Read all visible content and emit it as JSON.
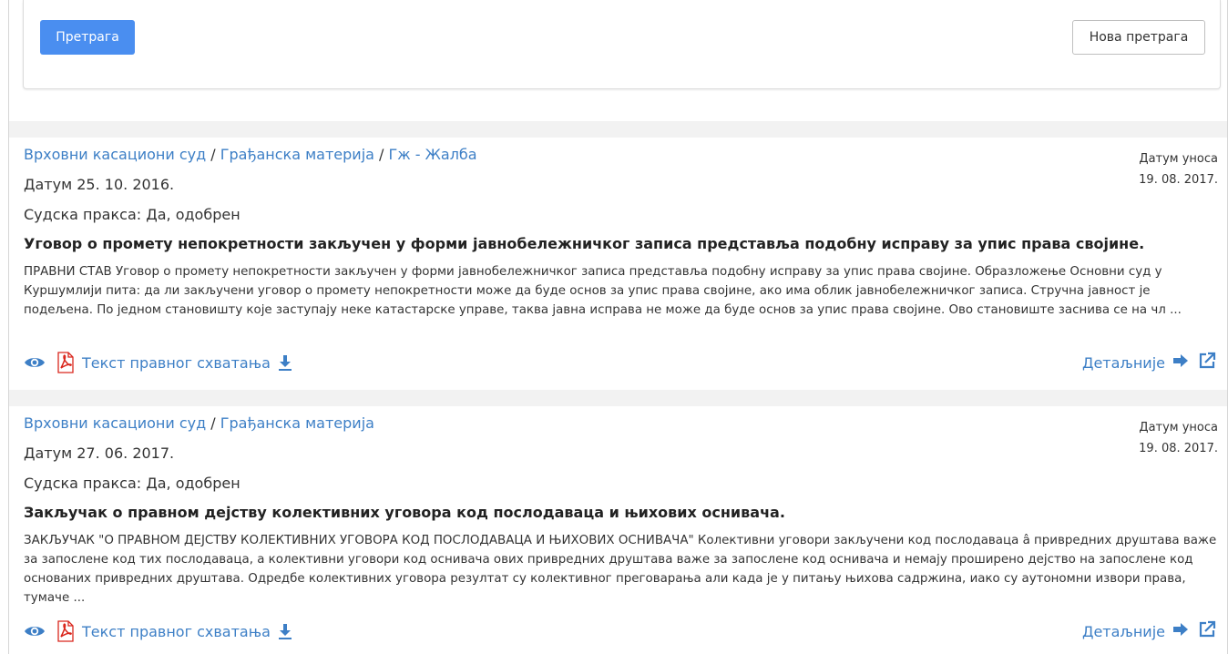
{
  "search_panel": {
    "search_label": "Претрага",
    "new_search_label": "Нова претрага"
  },
  "results": [
    {
      "court": "Врховни касациони суд",
      "matter": "Грађанска материја",
      "category": "Гж - Жалба",
      "sep1": "/",
      "sep2": "/",
      "date": "Датум 25. 10. 2016.",
      "practice": "Судска пракса: Да, одобрен",
      "title": "Уговор о промету непокретности закључен у форми јавнобележничког записа представља подобну исправу за упис права својине.",
      "excerpt": "ПРАВНИ СТАВ Уговор о промету непокретности закључен у форми јавнобележничког записа представља подобну исправу за упис права својине. Образложење Основни суд у Куршумлији пита: да ли закључени уговор о промету непокретности може да буде основ за упис права својине, ако има облик јавнобележничког записа. Стручна јавност је подељена. По једном становишту које заступају неке катастарске управе, таква јавна исправа не може да буде основ за упис права својине. Ово становиште заснива се на чл ...",
      "entry_label": "Датум уноса",
      "entry_date": "19. 08. 2017.",
      "doc_label": "Текст правног схватања",
      "details_label": "Детаљније"
    },
    {
      "court": "Врховни касациони суд",
      "matter": "Грађанска материја",
      "sep1": "/",
      "date": "Датум 27. 06. 2017.",
      "practice": "Судска пракса: Да, одобрен",
      "title": "Закључак о правном дејству колективних уговора код послодаваца и њихових оснивача.",
      "excerpt": "ЗАКЉУЧАК \"О ПРАВНОМ ДЕЈСТВУ КОЛЕКТИВНИХ УГОВОРА КОД ПОСЛОДАВАЦА И ЊИХОВИХ ОСНИВАЧА\" Колективни уговори закључени код послодаваца â привредних друштава важе за запослене код тих послодаваца, а колективни уговори код оснивача ових привредних друштава важе за запослене код оснивача и немају проширено дејство на запослене код основаних привредних друштава. Одредбе колективних уговора резултат су колективног преговарања али када је у питању њихова садржина, иако су аутономни извори права, тумаче ...",
      "entry_label": "Датум уноса",
      "entry_date": "19. 08. 2017.",
      "doc_label": "Текст правног схватања",
      "details_label": "Детаљније"
    }
  ],
  "colors": {
    "accent": "#4a8ef0",
    "link": "#3d7fc6",
    "pdf_red": "#d9261c",
    "separator": "#f2f2f2"
  },
  "icons": [
    "eye-icon",
    "pdf-icon",
    "download-icon",
    "arrow-right-icon",
    "external-link-icon"
  ]
}
